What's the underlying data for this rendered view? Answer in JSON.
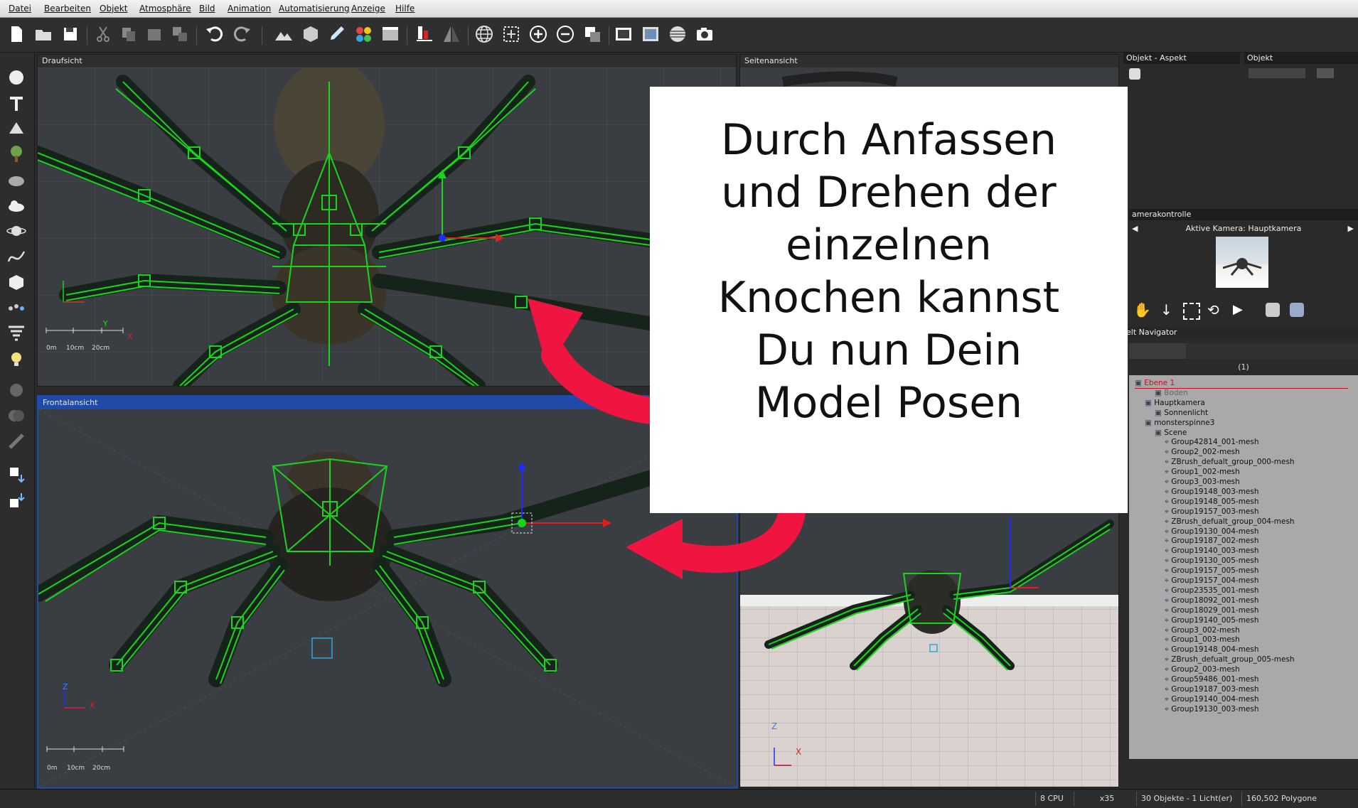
{
  "menu": [
    "Datei",
    "Bearbeiten",
    "Objekt",
    "Atmosphäre",
    "Bild",
    "Animation",
    "Automatisierung",
    "Anzeige",
    "Hilfe"
  ],
  "toolbar_icons": [
    "new-document-icon",
    "open-folder-icon",
    "save-icon",
    "cut-icon",
    "copy-icon",
    "paste-icon",
    "duplicate-icon",
    "undo-icon",
    "redo-icon",
    "terrain-icon",
    "object-box-icon",
    "paint-icon",
    "materials-icon",
    "render-scene-icon",
    "align-icon",
    "symmetry-icon",
    "globe-icon",
    "frame-select-icon",
    "zoom-in-icon",
    "zoom-out-icon",
    "drop-icon",
    "display-icon",
    "render-icon",
    "background-icon",
    "camera-icon"
  ],
  "viewports": {
    "top": {
      "title": "Draufsicht",
      "scale": [
        "0m",
        "10cm",
        "20cm"
      ],
      "axes": [
        "Y",
        "X"
      ]
    },
    "side": {
      "title": "Seitenansicht"
    },
    "front": {
      "title": "Frontalansicht",
      "scale": [
        "0m",
        "10cm",
        "20cm"
      ],
      "axes": [
        "Z",
        "X"
      ]
    },
    "camera": {
      "axes": [
        "Z",
        "X"
      ]
    }
  },
  "overlay_text": "Durch Anfassen\nund Drehen der\neinzelnen\nKnochen kannst\nDu nun Dein\nModel Posen",
  "panels": {
    "aspect_title": "Objekt - Aspekt",
    "object_title": "Objekt",
    "camera_control_title": "amerakontrolle",
    "active_camera": "Aktive Kamera: Hauptkamera",
    "world_navigator_title": "elt Navigator",
    "nav_count": "(1)"
  },
  "tree": [
    {
      "label": "Ebene 1",
      "indent": 0,
      "selected": true
    },
    {
      "label": "Boden",
      "indent": 2,
      "dim": true
    },
    {
      "label": "Hauptkamera",
      "indent": 1
    },
    {
      "label": "Sonnenlicht",
      "indent": 2
    },
    {
      "label": "monsterspinne3",
      "indent": 1
    },
    {
      "label": "Scene",
      "indent": 2
    },
    {
      "label": "Group42814_001-mesh",
      "indent": 3
    },
    {
      "label": "Group2_002-mesh",
      "indent": 3
    },
    {
      "label": "ZBrush_defualt_group_000-mesh",
      "indent": 3
    },
    {
      "label": "Group1_002-mesh",
      "indent": 3
    },
    {
      "label": "Group3_003-mesh",
      "indent": 3
    },
    {
      "label": "Group19148_003-mesh",
      "indent": 3
    },
    {
      "label": "Group19148_005-mesh",
      "indent": 3
    },
    {
      "label": "Group19157_003-mesh",
      "indent": 3
    },
    {
      "label": "ZBrush_defualt_group_004-mesh",
      "indent": 3
    },
    {
      "label": "Group19130_004-mesh",
      "indent": 3
    },
    {
      "label": "Group19187_002-mesh",
      "indent": 3
    },
    {
      "label": "Group19140_003-mesh",
      "indent": 3
    },
    {
      "label": "Group19130_005-mesh",
      "indent": 3
    },
    {
      "label": "Group19157_005-mesh",
      "indent": 3
    },
    {
      "label": "Group19157_004-mesh",
      "indent": 3
    },
    {
      "label": "Group23535_001-mesh",
      "indent": 3
    },
    {
      "label": "Group18092_001-mesh",
      "indent": 3
    },
    {
      "label": "Group18029_001-mesh",
      "indent": 3
    },
    {
      "label": "Group19140_005-mesh",
      "indent": 3
    },
    {
      "label": "Group3_002-mesh",
      "indent": 3
    },
    {
      "label": "Group1_003-mesh",
      "indent": 3
    },
    {
      "label": "Group19148_004-mesh",
      "indent": 3
    },
    {
      "label": "ZBrush_defualt_group_005-mesh",
      "indent": 3
    },
    {
      "label": "Group2_003-mesh",
      "indent": 3
    },
    {
      "label": "Group59486_001-mesh",
      "indent": 3
    },
    {
      "label": "Group19187_003-mesh",
      "indent": 3
    },
    {
      "label": "Group19140_004-mesh",
      "indent": 3
    },
    {
      "label": "Group19130_003-mesh",
      "indent": 3
    }
  ],
  "status": {
    "cpu": "8 CPU",
    "zoom": "x35",
    "objects": "30 Objekte - 1 Licht(er)",
    "polygons": "160,502 Polygone"
  },
  "colors": {
    "bone": "#18d51b",
    "accent_arrow": "#ef1540",
    "viewport_bg": "#3a3d42",
    "active_header": "#1f4aa8"
  }
}
